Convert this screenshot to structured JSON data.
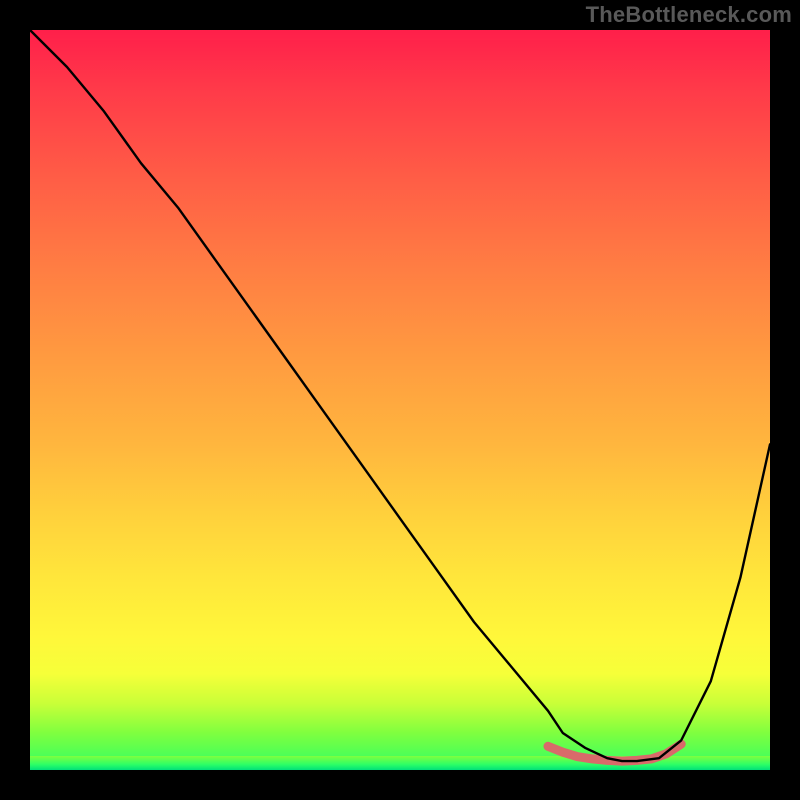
{
  "watermark": "TheBottleneck.com",
  "chart_data": {
    "type": "line",
    "title": "",
    "xlabel": "",
    "ylabel": "",
    "xlim": [
      0,
      100
    ],
    "ylim": [
      0,
      100
    ],
    "grid": false,
    "legend": false,
    "series": [
      {
        "name": "bottleneck-curve",
        "color": "#000000",
        "x": [
          0,
          5,
          10,
          15,
          20,
          25,
          30,
          35,
          40,
          45,
          50,
          55,
          60,
          65,
          70,
          72,
          75,
          78,
          80,
          82,
          85,
          88,
          92,
          96,
          100
        ],
        "y": [
          100,
          95,
          89,
          82,
          76,
          69,
          62,
          55,
          48,
          41,
          34,
          27,
          20,
          14,
          8,
          5,
          3,
          1.6,
          1.2,
          1.2,
          1.6,
          4,
          12,
          26,
          44
        ]
      },
      {
        "name": "bottleneck-zone",
        "color": "#d86a6a",
        "x": [
          70,
          72,
          74,
          76,
          78,
          80,
          82,
          84,
          86,
          88
        ],
        "y": [
          3.2,
          2.4,
          1.8,
          1.5,
          1.3,
          1.2,
          1.3,
          1.5,
          2.2,
          3.5
        ]
      }
    ],
    "min_point": {
      "x": 80,
      "y": 1.2
    },
    "gradient_stops": [
      {
        "pos": 0,
        "color": "#ff1f4a"
      },
      {
        "pos": 20,
        "color": "#ff5d46"
      },
      {
        "pos": 44,
        "color": "#ff9a40"
      },
      {
        "pos": 66,
        "color": "#ffd23c"
      },
      {
        "pos": 82,
        "color": "#fff73a"
      },
      {
        "pos": 91,
        "color": "#c9ff38"
      },
      {
        "pos": 100,
        "color": "#2dff66"
      }
    ]
  }
}
